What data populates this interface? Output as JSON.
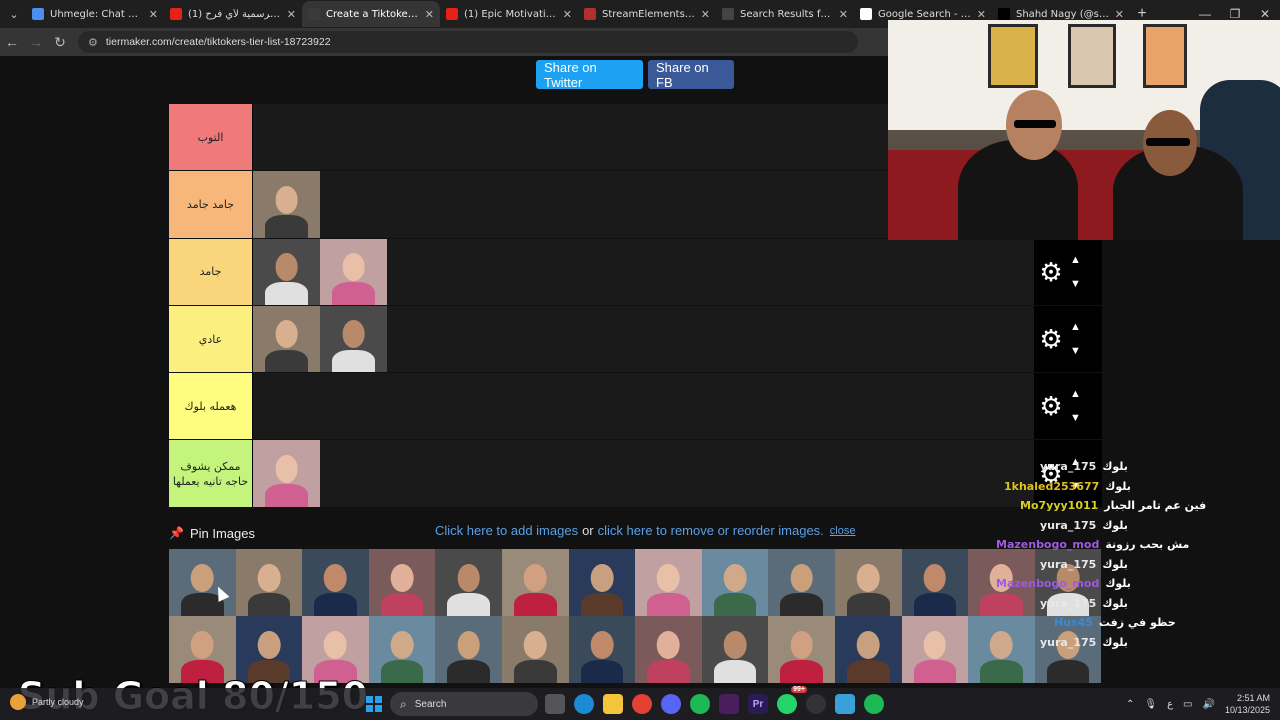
{
  "browser": {
    "tabs": [
      {
        "title": "Uhmegle: Chat with Strangers",
        "favicon_color": "#4a8ef0",
        "active": false
      },
      {
        "title": "(1) الأغنية الرسمية لأي فرح",
        "favicon_color": "#e62117",
        "active": false
      },
      {
        "title": "Create a Tiktokers Tier List",
        "favicon_color": "#3a3a3a",
        "active": true
      },
      {
        "title": "(1) Epic Motivational Music",
        "favicon_color": "#e62117",
        "active": false
      },
      {
        "title": "StreamElements | Subathon",
        "favicon_color": "#b03030",
        "active": false
      },
      {
        "title": "Search Results for 'مصرية'",
        "favicon_color": "#444444",
        "active": false
      },
      {
        "title": "Google Search - احمد جاسر",
        "favicon_color": "#ffffff",
        "active": false
      },
      {
        "title": "Shahd Nagy (@shahd_nagy)",
        "favicon_color": "#000000",
        "active": false
      }
    ],
    "url": "tiermaker.com/create/tiktokers-tier-list-18723922"
  },
  "share": {
    "twitter_label": "Share on Twitter",
    "facebook_label": "Share on FB"
  },
  "tiers": [
    {
      "label": "التوب",
      "color": "#f07a7a",
      "items": 0
    },
    {
      "label": "جامد جامد",
      "color": "#f7b77b",
      "items": 1
    },
    {
      "label": "جامد",
      "color": "#f9d67c",
      "items": 2
    },
    {
      "label": "عادي",
      "color": "#fbf07f",
      "items": 2
    },
    {
      "label": "هعمله بلوك",
      "color": "#fffd80",
      "items": 0
    },
    {
      "label": "ممكن يشوف حاجه تانيه يعملها",
      "color": "#c4f47c",
      "items": 1
    }
  ],
  "pin": {
    "label": "Pin Images",
    "add_link": "Click here to add images",
    "or_text": "or",
    "remove_link": "click here to remove or reorder images.",
    "close_label": "close"
  },
  "chat": [
    {
      "user": "yura_175",
      "msg": "بلوك",
      "color": "#e8e8e8"
    },
    {
      "user": "1khaled253677",
      "msg": "بلوك",
      "color": "#e0c020"
    },
    {
      "user": "Mo7yyy1011",
      "msg": "فين عم تامر الجبار",
      "color": "#d8d020"
    },
    {
      "user": "yura_175",
      "msg": "بلوك",
      "color": "#e8e8e8"
    },
    {
      "user": "Mazenbogo_mod",
      "msg": "مش بحب رزونة",
      "color": "#a05ae0"
    },
    {
      "user": "yura_175",
      "msg": "بلوك",
      "color": "#e8e8e8"
    },
    {
      "user": "Mazenbogo_mod",
      "msg": "بلوك",
      "color": "#a05ae0"
    },
    {
      "user": "yura_175",
      "msg": "بلوك",
      "color": "#e8e8e8"
    },
    {
      "user": "Hus45",
      "msg": "حظو في زفت",
      "color": "#3a8ad8"
    },
    {
      "user": "yura_175",
      "msg": "بلوك",
      "color": "#e8e8e8"
    }
  ],
  "overlay": {
    "sub_goal": "Sub Goal 80/150"
  },
  "taskbar": {
    "search_placeholder": "Search",
    "weather": "Partly cloudy",
    "notification_badge": "99+",
    "time": "2:51 AM",
    "date": "10/13/2025",
    "lang": "ع"
  }
}
